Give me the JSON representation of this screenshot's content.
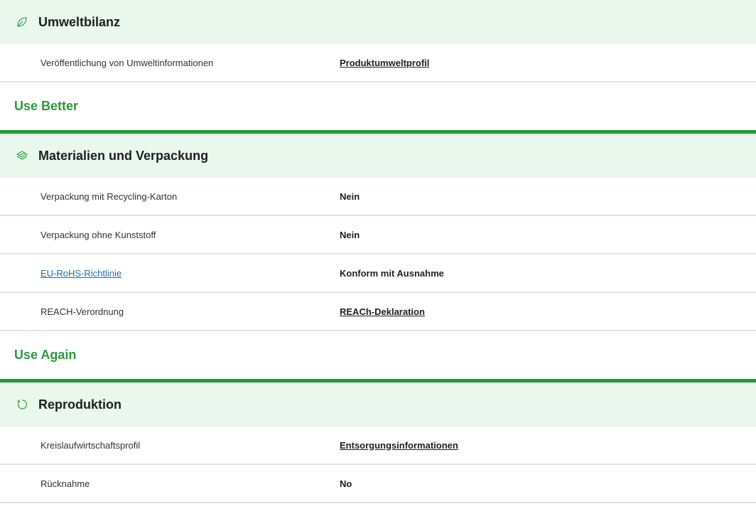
{
  "sections": [
    {
      "title": "Umweltbilanz",
      "icon": "leaf-icon",
      "rows": [
        {
          "label": "Veröffentlichung von Umweltinformationen",
          "value": "Produktumweltprofil",
          "value_is_link": true
        }
      ]
    },
    {
      "group": "Use Better",
      "title": "Materialien und Verpackung",
      "icon": "layers-icon",
      "rows": [
        {
          "label": "Verpackung mit Recycling-Karton",
          "value": "Nein"
        },
        {
          "label": "Verpackung ohne Kunststoff",
          "value": "Nein"
        },
        {
          "label": "EU-RoHS-Richtlinie",
          "label_is_link": true,
          "value": "Konform mit Ausnahme"
        },
        {
          "label": "REACH-Verordnung",
          "value": "REACh-Deklaration",
          "value_is_link": true
        }
      ]
    },
    {
      "group": "Use Again",
      "title": "Reproduktion",
      "icon": "refresh-icon",
      "rows": [
        {
          "label": "Kreislaufwirtschaftsprofil",
          "value": "Entsorgungsinformationen",
          "value_is_link": true
        },
        {
          "label": "Rücknahme",
          "value": "No"
        }
      ]
    }
  ],
  "colors": {
    "accent_green": "#1e9c34",
    "heading_green": "#2b9a3b",
    "header_bg": "#e9f7ec",
    "link_blue": "#1a6fa8"
  }
}
